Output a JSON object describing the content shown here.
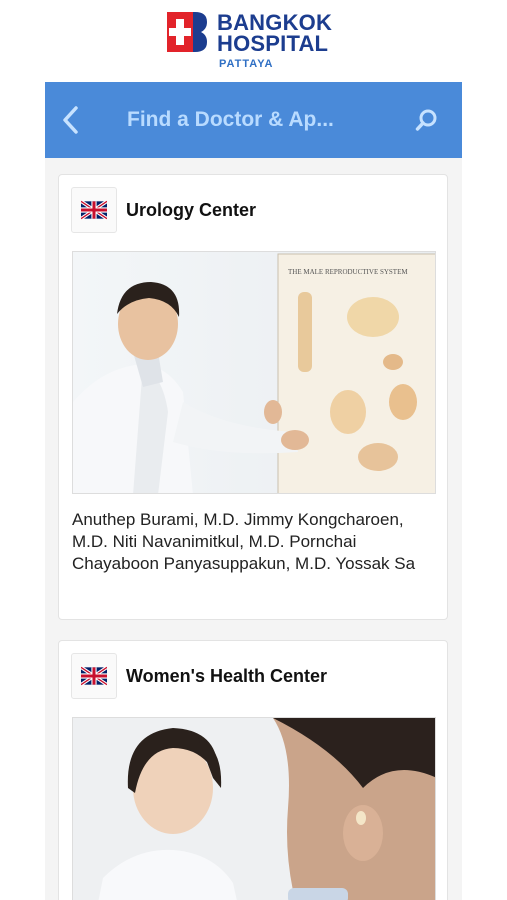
{
  "brand": {
    "line1": "BANGKOK",
    "line2": "HOSPITAL",
    "sub": "PATTAYA",
    "colors": {
      "navy": "#1c3d8f",
      "red": "#e2232a",
      "accent": "#2f6fc4"
    }
  },
  "topbar": {
    "title": "Find a Doctor & Ap...",
    "back_icon": "chevron-left-icon",
    "search_icon": "search-icon",
    "color": "#4a8ad9"
  },
  "cards": [
    {
      "flag_icon": "uk-flag-icon",
      "title": "Urology Center",
      "doctors": " Anuthep Burami, M.D.  Jimmy Kongcharoen, M.D.  Niti Navanimitkul, M.D.  Pornchai Chayaboon Panyasuppakun, M.D.  Yossak Sa",
      "photo_caption": "THE MALE REPRODUCTIVE SYSTEM"
    },
    {
      "flag_icon": "uk-flag-icon",
      "title": "Women's Health Center"
    }
  ]
}
